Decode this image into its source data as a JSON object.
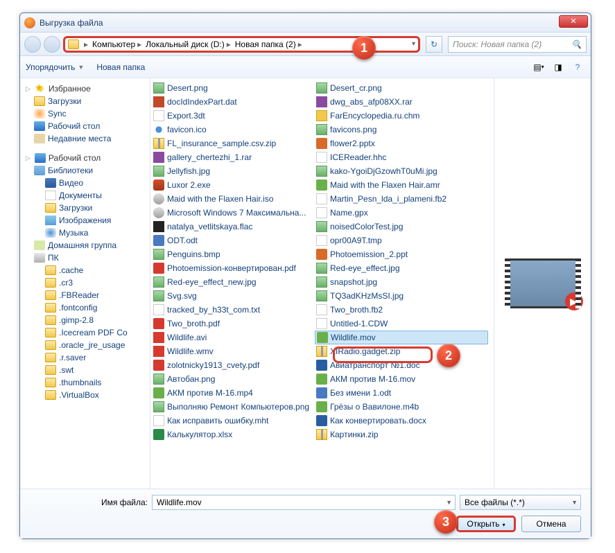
{
  "window": {
    "title": "Выгрузка файла"
  },
  "breadcrumb": [
    "Компьютер",
    "Локальный диск (D:)",
    "Новая папка (2)"
  ],
  "search": {
    "placeholder": "Поиск: Новая папка (2)"
  },
  "toolbar": {
    "organize": "Упорядочить",
    "newfolder": "Новая папка"
  },
  "sidebar": {
    "favorites": {
      "label": "Избранное",
      "items": [
        "Загрузки",
        "Sync",
        "Рабочий стол",
        "Недавние места"
      ]
    },
    "desktop": {
      "label": "Рабочий стол"
    },
    "libraries": {
      "label": "Библиотеки",
      "items": [
        "Видео",
        "Документы",
        "Загрузки",
        "Изображения",
        "Музыка"
      ]
    },
    "homegroup": {
      "label": "Домашняя группа"
    },
    "pc": {
      "label": "ПК",
      "items": [
        ".cache",
        ".cr3",
        ".FBReader",
        ".fontconfig",
        ".gimp-2.8",
        ".Icecream PDF Co",
        ".oracle_jre_usage",
        ".r.saver",
        ".swt",
        ".thumbnails",
        ".VirtualBox"
      ]
    }
  },
  "files_col1": [
    {
      "name": "Desert.png",
      "ico": "img"
    },
    {
      "name": "docIdIndexPart.dat",
      "ico": "dat"
    },
    {
      "name": "Export.3dt",
      "ico": "txt"
    },
    {
      "name": "favicon.ico",
      "ico": "ico"
    },
    {
      "name": "FL_insurance_sample.csv.zip",
      "ico": "zip"
    },
    {
      "name": "gallery_chertezhi_1.rar",
      "ico": "rar"
    },
    {
      "name": "Jellyfish.jpg",
      "ico": "img"
    },
    {
      "name": "Luxor 2.exe",
      "ico": "exe"
    },
    {
      "name": "Maid with the Flaxen Hair.iso",
      "ico": "iso"
    },
    {
      "name": "Microsoft Windows 7 Максимальна...",
      "ico": "iso"
    },
    {
      "name": "natalya_vetlitskaya.flac",
      "ico": "flac"
    },
    {
      "name": "ODT.odt",
      "ico": "odt"
    },
    {
      "name": "Penguins.bmp",
      "ico": "img"
    },
    {
      "name": "Photoemission-конвертирован.pdf",
      "ico": "pdf"
    },
    {
      "name": "Red-eye_effect_new.jpg",
      "ico": "img"
    },
    {
      "name": "Svg.svg",
      "ico": "img"
    },
    {
      "name": "tracked_by_h33t_com.txt",
      "ico": "txt"
    },
    {
      "name": "Two_broth.pdf",
      "ico": "pdf"
    },
    {
      "name": "Wildlife.avi",
      "ico": "avi"
    },
    {
      "name": "Wildlife.wmv",
      "ico": "wmv"
    },
    {
      "name": "zolotnicky1913_cvety.pdf",
      "ico": "pdf"
    },
    {
      "name": "Автобан.png",
      "ico": "img"
    },
    {
      "name": "АКМ против М-16.mp4",
      "ico": "mp4"
    },
    {
      "name": "Выполняю Ремонт Компьютеров.png",
      "ico": "img"
    },
    {
      "name": "Как исправить ошибку.mht",
      "ico": "txt"
    },
    {
      "name": "Калькулятор.xlsx",
      "ico": "xlsx"
    }
  ],
  "files_col2": [
    {
      "name": "Desert_cr.png",
      "ico": "img"
    },
    {
      "name": "dwg_abs_afp08XX.rar",
      "ico": "rar"
    },
    {
      "name": "FarEncyclopedia.ru.chm",
      "ico": "chm"
    },
    {
      "name": "favicons.png",
      "ico": "img"
    },
    {
      "name": "flower2.pptx",
      "ico": "pptx"
    },
    {
      "name": "ICEReader.hhc",
      "ico": "txt"
    },
    {
      "name": "kako-YgoiDjGzowhT0uMi.jpg",
      "ico": "img"
    },
    {
      "name": "Maid with the Flaxen Hair.amr",
      "ico": "mov"
    },
    {
      "name": "Martin_Pesn_lda_i_plameni.fb2",
      "ico": "txt"
    },
    {
      "name": "Name.gpx",
      "ico": "txt"
    },
    {
      "name": "noisedColorTest.jpg",
      "ico": "img"
    },
    {
      "name": "opr00A9T.tmp",
      "ico": "txt"
    },
    {
      "name": "Photoemission_2.ppt",
      "ico": "pptx"
    },
    {
      "name": "Red-eye_effect.jpg",
      "ico": "img"
    },
    {
      "name": "snapshot.jpg",
      "ico": "img"
    },
    {
      "name": "TQ3adKHzMsSI.jpg",
      "ico": "img"
    },
    {
      "name": "Two_broth.fb2",
      "ico": "txt"
    },
    {
      "name": "Untitled-1.CDW",
      "ico": "txt"
    },
    {
      "name": "Wildlife.mov",
      "ico": "mov",
      "selected": true
    },
    {
      "name": "XIRadio.gadget.zip",
      "ico": "zip"
    },
    {
      "name": "Авиатранспорт №1.doc",
      "ico": "docx"
    },
    {
      "name": "АКМ против М-16.mov",
      "ico": "mov"
    },
    {
      "name": "Без имени 1.odt",
      "ico": "odt"
    },
    {
      "name": "Грёзы о Вавилоне.m4b",
      "ico": "mov"
    },
    {
      "name": "Как конвертировать.docx",
      "ico": "docx"
    },
    {
      "name": "Картинки.zip",
      "ico": "zip"
    }
  ],
  "footer": {
    "filename_label": "Имя файла:",
    "filename_value": "Wildlife.mov",
    "filter": "Все файлы (*.*)",
    "open": "Открыть",
    "cancel": "Отмена"
  },
  "callouts": {
    "c1": "1",
    "c2": "2",
    "c3": "3"
  }
}
